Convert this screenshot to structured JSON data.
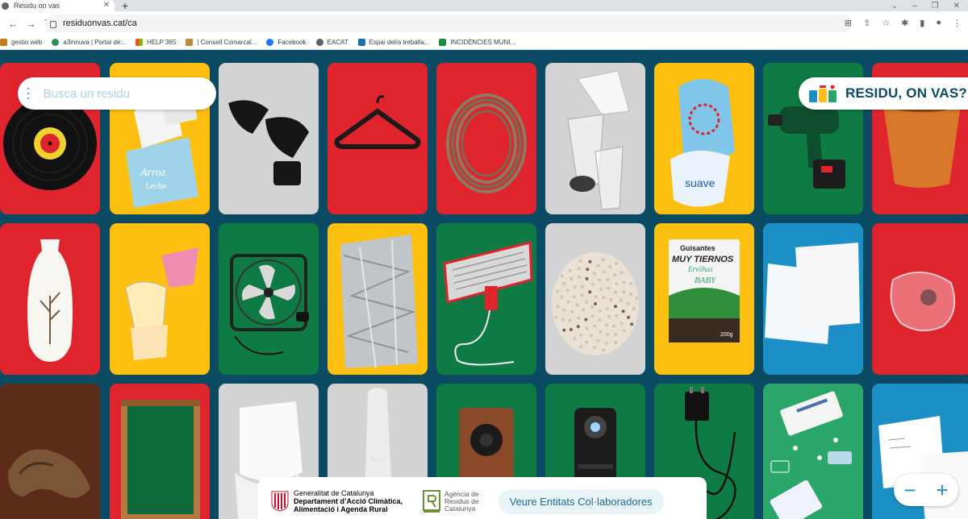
{
  "browser": {
    "tab_title": "Residu on vas",
    "url": "residuonvas.cat/ca",
    "bookmarks": [
      "gestio web",
      "a3innuva | Portal de...",
      "HELP 365",
      "| Consell Comarcal...",
      "Facebook",
      "EACAT",
      "Espai del/a treballa...",
      "INCIDÈNCIES MUNI..."
    ]
  },
  "search": {
    "placeholder": "Busca un residu"
  },
  "brand": {
    "title": "RESIDU, ON VAS?"
  },
  "footer": {
    "gencat_line1": "Generalitat de Catalunya",
    "gencat_line2": "Departament d’Acció Climàtica,",
    "gencat_line3": "Alimentació i Agenda Rural",
    "arc_line1": "Agència de",
    "arc_line2": "Residus de",
    "arc_line3": "Catalunya",
    "partners_label": "Veure Entitats Col·laboradores"
  },
  "zoom": {
    "minus": "−",
    "plus": "+"
  },
  "colors": {
    "red": "#e0242e",
    "yellow": "#fdc010",
    "green": "#0e7a44",
    "grey": "#d3d3d3",
    "blue": "#1b8fc6",
    "brown": "#5b2c1a",
    "teal": "#2aa66b",
    "dark": "#0b4a63"
  },
  "card_items": [
    {
      "bg": "red",
      "item": "vinyl-record"
    },
    {
      "bg": "yellow",
      "item": "milk-carton"
    },
    {
      "bg": "grey",
      "item": "sunglasses"
    },
    {
      "bg": "red",
      "item": "hanger"
    },
    {
      "bg": "red",
      "item": "hose"
    },
    {
      "bg": "grey",
      "item": "plastic-cups"
    },
    {
      "bg": "yellow",
      "item": "plastic-bags"
    },
    {
      "bg": "green",
      "item": "drill"
    },
    {
      "bg": "red",
      "item": "flower-pot"
    },
    {
      "bg": "red",
      "item": "vase"
    },
    {
      "bg": "yellow",
      "item": "yogurt-cups"
    },
    {
      "bg": "green",
      "item": "fan"
    },
    {
      "bg": "yellow",
      "item": "aluminium-foil"
    },
    {
      "bg": "green",
      "item": "heater"
    },
    {
      "bg": "grey",
      "item": "granules"
    },
    {
      "bg": "yellow",
      "item": "pea-bag"
    },
    {
      "bg": "blue",
      "item": "paper"
    },
    {
      "bg": "red",
      "item": "broken-glass"
    },
    {
      "bg": "brown",
      "item": "bread"
    },
    {
      "bg": "red",
      "item": "frame"
    },
    {
      "bg": "grey",
      "item": "diaper"
    },
    {
      "bg": "grey",
      "item": "condom"
    },
    {
      "bg": "green",
      "item": "speaker"
    },
    {
      "bg": "green",
      "item": "coffee-machine"
    },
    {
      "bg": "green",
      "item": "charger"
    },
    {
      "bg": "teal",
      "item": "medicine"
    },
    {
      "bg": "blue",
      "item": "papers"
    }
  ],
  "card_text": {
    "suave": "suave",
    "arroz": "Arroz",
    "leche": "Leche",
    "guisantes": "Guisantes",
    "muy_tiernos": "MUY TIERNOS",
    "ervilhas": "Ervilhas",
    "baby": "BABY",
    "weight": "200g"
  }
}
